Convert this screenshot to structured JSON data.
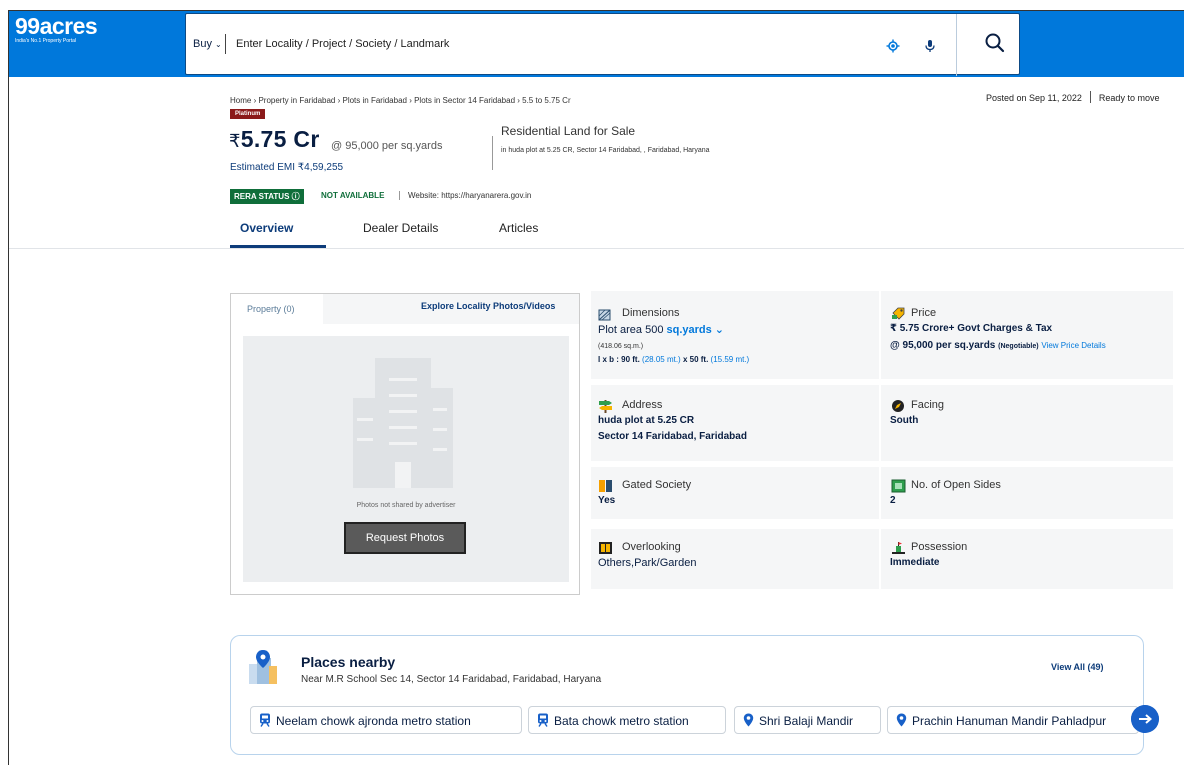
{
  "header": {
    "logo_brand": "99acres",
    "logo_tagline": "India's No.1 Property Portal",
    "buy_label": "Buy",
    "search_placeholder": "Enter Locality / Project / Society / Landmark"
  },
  "breadcrumb": "Home › Property in Faridabad › Plots in Faridabad › Plots in Sector 14 Faridabad › 5.5 to 5.75 Cr",
  "posted": {
    "date": "Posted on Sep 11, 2022",
    "status": "Ready to move"
  },
  "listing": {
    "badge": "Platinum",
    "currency": "₹",
    "price": "5.75 Cr",
    "rate": "@ 95,000 per sq.yards",
    "emi": "Estimated EMI ₹4,59,255",
    "type": "Residential Land for Sale",
    "location": "in huda plot at 5.25 CR, Sector 14 Faridabad, , Faridabad, Haryana"
  },
  "rera": {
    "badge": "RERA STATUS",
    "status": "NOT AVAILABLE",
    "website": "Website: https://haryanarera.gov.in"
  },
  "tabs": [
    "Overview",
    "Dealer Details",
    "Articles"
  ],
  "photos": {
    "tab": "Property (0)",
    "explore": "Explore Locality Photos/Videos",
    "empty_text": "Photos not shared by advertiser",
    "request_button": "Request Photos"
  },
  "details": {
    "dimensions": {
      "label": "Dimensions",
      "area_text": "Plot area 500",
      "unit": "sq.yards",
      "sqm": "(418.06 sq.m.)",
      "lxb_prefix": "l x b : 90 ft.",
      "l_mt": "(28.05 mt.)",
      "x_text": "x 50 ft.",
      "b_mt": "(15.59 mt.)"
    },
    "price": {
      "label": "Price",
      "value": "₹ 5.75 Crore+ Govt Charges & Tax",
      "rate": "@ 95,000 per sq.yards",
      "negotiable": "(Negotiable)",
      "link": "View Price Details"
    },
    "address": {
      "label": "Address",
      "line1": "huda plot at 5.25 CR",
      "line2": "Sector 14 Faridabad, Faridabad"
    },
    "facing": {
      "label": "Facing",
      "value": "South"
    },
    "gated": {
      "label": "Gated Society",
      "value": "Yes"
    },
    "open_sides": {
      "label": "No. of Open Sides",
      "value": "2"
    },
    "overlooking": {
      "label": "Overlooking",
      "value": "Others,Park/Garden"
    },
    "possession": {
      "label": "Possession",
      "value": "Immediate"
    }
  },
  "places": {
    "title": "Places nearby",
    "subtitle": "Near M.R School Sec 14, Sector 14 Faridabad, Faridabad, Haryana",
    "view_all": "View All (49)",
    "chips": [
      {
        "label": "Neelam chowk ajronda metro station",
        "icon": "metro-icon"
      },
      {
        "label": "Bata chowk metro station",
        "icon": "metro-icon"
      },
      {
        "label": "Shri Balaji Mandir",
        "icon": "location-pin-icon"
      },
      {
        "label": "Prachin Hanuman Mandir Pahladpur",
        "icon": "location-pin-icon"
      }
    ]
  },
  "colors": {
    "header_blue": "#0078db",
    "navy": "#091e42",
    "rera_green": "#0f6e3a",
    "platinum": "#8b1a1a"
  }
}
